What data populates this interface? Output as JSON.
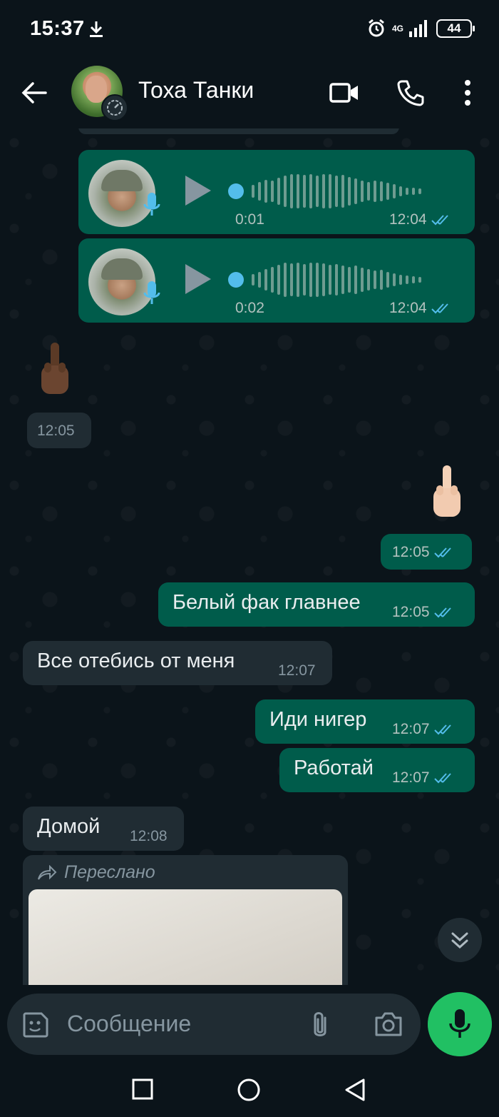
{
  "status_bar": {
    "time": "15:37",
    "network": "4G",
    "battery": "44"
  },
  "header": {
    "contact_name": "Тоха Танки"
  },
  "messages": {
    "voice1": {
      "duration": "0:01",
      "time": "12:04"
    },
    "voice2": {
      "duration": "0:02",
      "time": "12:04"
    },
    "emoji_in": {
      "time": "12:05"
    },
    "emoji_out": {
      "time": "12:05"
    },
    "m1": {
      "text": "Белый фак главнее",
      "time": "12:05"
    },
    "m2": {
      "text": "Все отебись от меня",
      "time": "12:07"
    },
    "m3": {
      "text": "Иди нигер",
      "time": "12:07"
    },
    "m4": {
      "text": "Работай",
      "time": "12:07"
    },
    "m5": {
      "text": "Домой",
      "time": "12:08"
    },
    "forwarded": {
      "label": "Переслано"
    }
  },
  "input": {
    "placeholder": "Сообщение"
  },
  "colors": {
    "outgoing": "#005c4b",
    "incoming": "#202c33",
    "accent": "#21c063",
    "read_ticks": "#53bdeb"
  }
}
